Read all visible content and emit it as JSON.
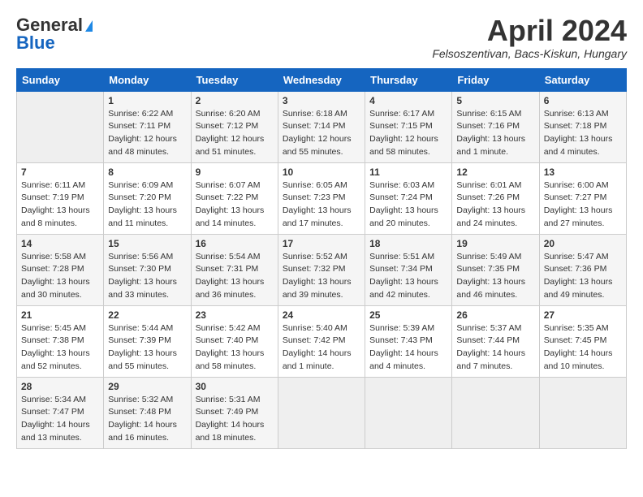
{
  "header": {
    "logo_line1": "General",
    "logo_line2": "Blue",
    "month_year": "April 2024",
    "location": "Felsoszentivan, Bacs-Kiskun, Hungary"
  },
  "weekdays": [
    "Sunday",
    "Monday",
    "Tuesday",
    "Wednesday",
    "Thursday",
    "Friday",
    "Saturday"
  ],
  "weeks": [
    [
      {
        "day": null,
        "info": null
      },
      {
        "day": "1",
        "info": "Sunrise: 6:22 AM\nSunset: 7:11 PM\nDaylight: 12 hours and 48 minutes."
      },
      {
        "day": "2",
        "info": "Sunrise: 6:20 AM\nSunset: 7:12 PM\nDaylight: 12 hours and 51 minutes."
      },
      {
        "day": "3",
        "info": "Sunrise: 6:18 AM\nSunset: 7:14 PM\nDaylight: 12 hours and 55 minutes."
      },
      {
        "day": "4",
        "info": "Sunrise: 6:17 AM\nSunset: 7:15 PM\nDaylight: 12 hours and 58 minutes."
      },
      {
        "day": "5",
        "info": "Sunrise: 6:15 AM\nSunset: 7:16 PM\nDaylight: 13 hours and 1 minute."
      },
      {
        "day": "6",
        "info": "Sunrise: 6:13 AM\nSunset: 7:18 PM\nDaylight: 13 hours and 4 minutes."
      }
    ],
    [
      {
        "day": "7",
        "info": "Sunrise: 6:11 AM\nSunset: 7:19 PM\nDaylight: 13 hours and 8 minutes."
      },
      {
        "day": "8",
        "info": "Sunrise: 6:09 AM\nSunset: 7:20 PM\nDaylight: 13 hours and 11 minutes."
      },
      {
        "day": "9",
        "info": "Sunrise: 6:07 AM\nSunset: 7:22 PM\nDaylight: 13 hours and 14 minutes."
      },
      {
        "day": "10",
        "info": "Sunrise: 6:05 AM\nSunset: 7:23 PM\nDaylight: 13 hours and 17 minutes."
      },
      {
        "day": "11",
        "info": "Sunrise: 6:03 AM\nSunset: 7:24 PM\nDaylight: 13 hours and 20 minutes."
      },
      {
        "day": "12",
        "info": "Sunrise: 6:01 AM\nSunset: 7:26 PM\nDaylight: 13 hours and 24 minutes."
      },
      {
        "day": "13",
        "info": "Sunrise: 6:00 AM\nSunset: 7:27 PM\nDaylight: 13 hours and 27 minutes."
      }
    ],
    [
      {
        "day": "14",
        "info": "Sunrise: 5:58 AM\nSunset: 7:28 PM\nDaylight: 13 hours and 30 minutes."
      },
      {
        "day": "15",
        "info": "Sunrise: 5:56 AM\nSunset: 7:30 PM\nDaylight: 13 hours and 33 minutes."
      },
      {
        "day": "16",
        "info": "Sunrise: 5:54 AM\nSunset: 7:31 PM\nDaylight: 13 hours and 36 minutes."
      },
      {
        "day": "17",
        "info": "Sunrise: 5:52 AM\nSunset: 7:32 PM\nDaylight: 13 hours and 39 minutes."
      },
      {
        "day": "18",
        "info": "Sunrise: 5:51 AM\nSunset: 7:34 PM\nDaylight: 13 hours and 42 minutes."
      },
      {
        "day": "19",
        "info": "Sunrise: 5:49 AM\nSunset: 7:35 PM\nDaylight: 13 hours and 46 minutes."
      },
      {
        "day": "20",
        "info": "Sunrise: 5:47 AM\nSunset: 7:36 PM\nDaylight: 13 hours and 49 minutes."
      }
    ],
    [
      {
        "day": "21",
        "info": "Sunrise: 5:45 AM\nSunset: 7:38 PM\nDaylight: 13 hours and 52 minutes."
      },
      {
        "day": "22",
        "info": "Sunrise: 5:44 AM\nSunset: 7:39 PM\nDaylight: 13 hours and 55 minutes."
      },
      {
        "day": "23",
        "info": "Sunrise: 5:42 AM\nSunset: 7:40 PM\nDaylight: 13 hours and 58 minutes."
      },
      {
        "day": "24",
        "info": "Sunrise: 5:40 AM\nSunset: 7:42 PM\nDaylight: 14 hours and 1 minute."
      },
      {
        "day": "25",
        "info": "Sunrise: 5:39 AM\nSunset: 7:43 PM\nDaylight: 14 hours and 4 minutes."
      },
      {
        "day": "26",
        "info": "Sunrise: 5:37 AM\nSunset: 7:44 PM\nDaylight: 14 hours and 7 minutes."
      },
      {
        "day": "27",
        "info": "Sunrise: 5:35 AM\nSunset: 7:45 PM\nDaylight: 14 hours and 10 minutes."
      }
    ],
    [
      {
        "day": "28",
        "info": "Sunrise: 5:34 AM\nSunset: 7:47 PM\nDaylight: 14 hours and 13 minutes."
      },
      {
        "day": "29",
        "info": "Sunrise: 5:32 AM\nSunset: 7:48 PM\nDaylight: 14 hours and 16 minutes."
      },
      {
        "day": "30",
        "info": "Sunrise: 5:31 AM\nSunset: 7:49 PM\nDaylight: 14 hours and 18 minutes."
      },
      {
        "day": null,
        "info": null
      },
      {
        "day": null,
        "info": null
      },
      {
        "day": null,
        "info": null
      },
      {
        "day": null,
        "info": null
      }
    ]
  ]
}
